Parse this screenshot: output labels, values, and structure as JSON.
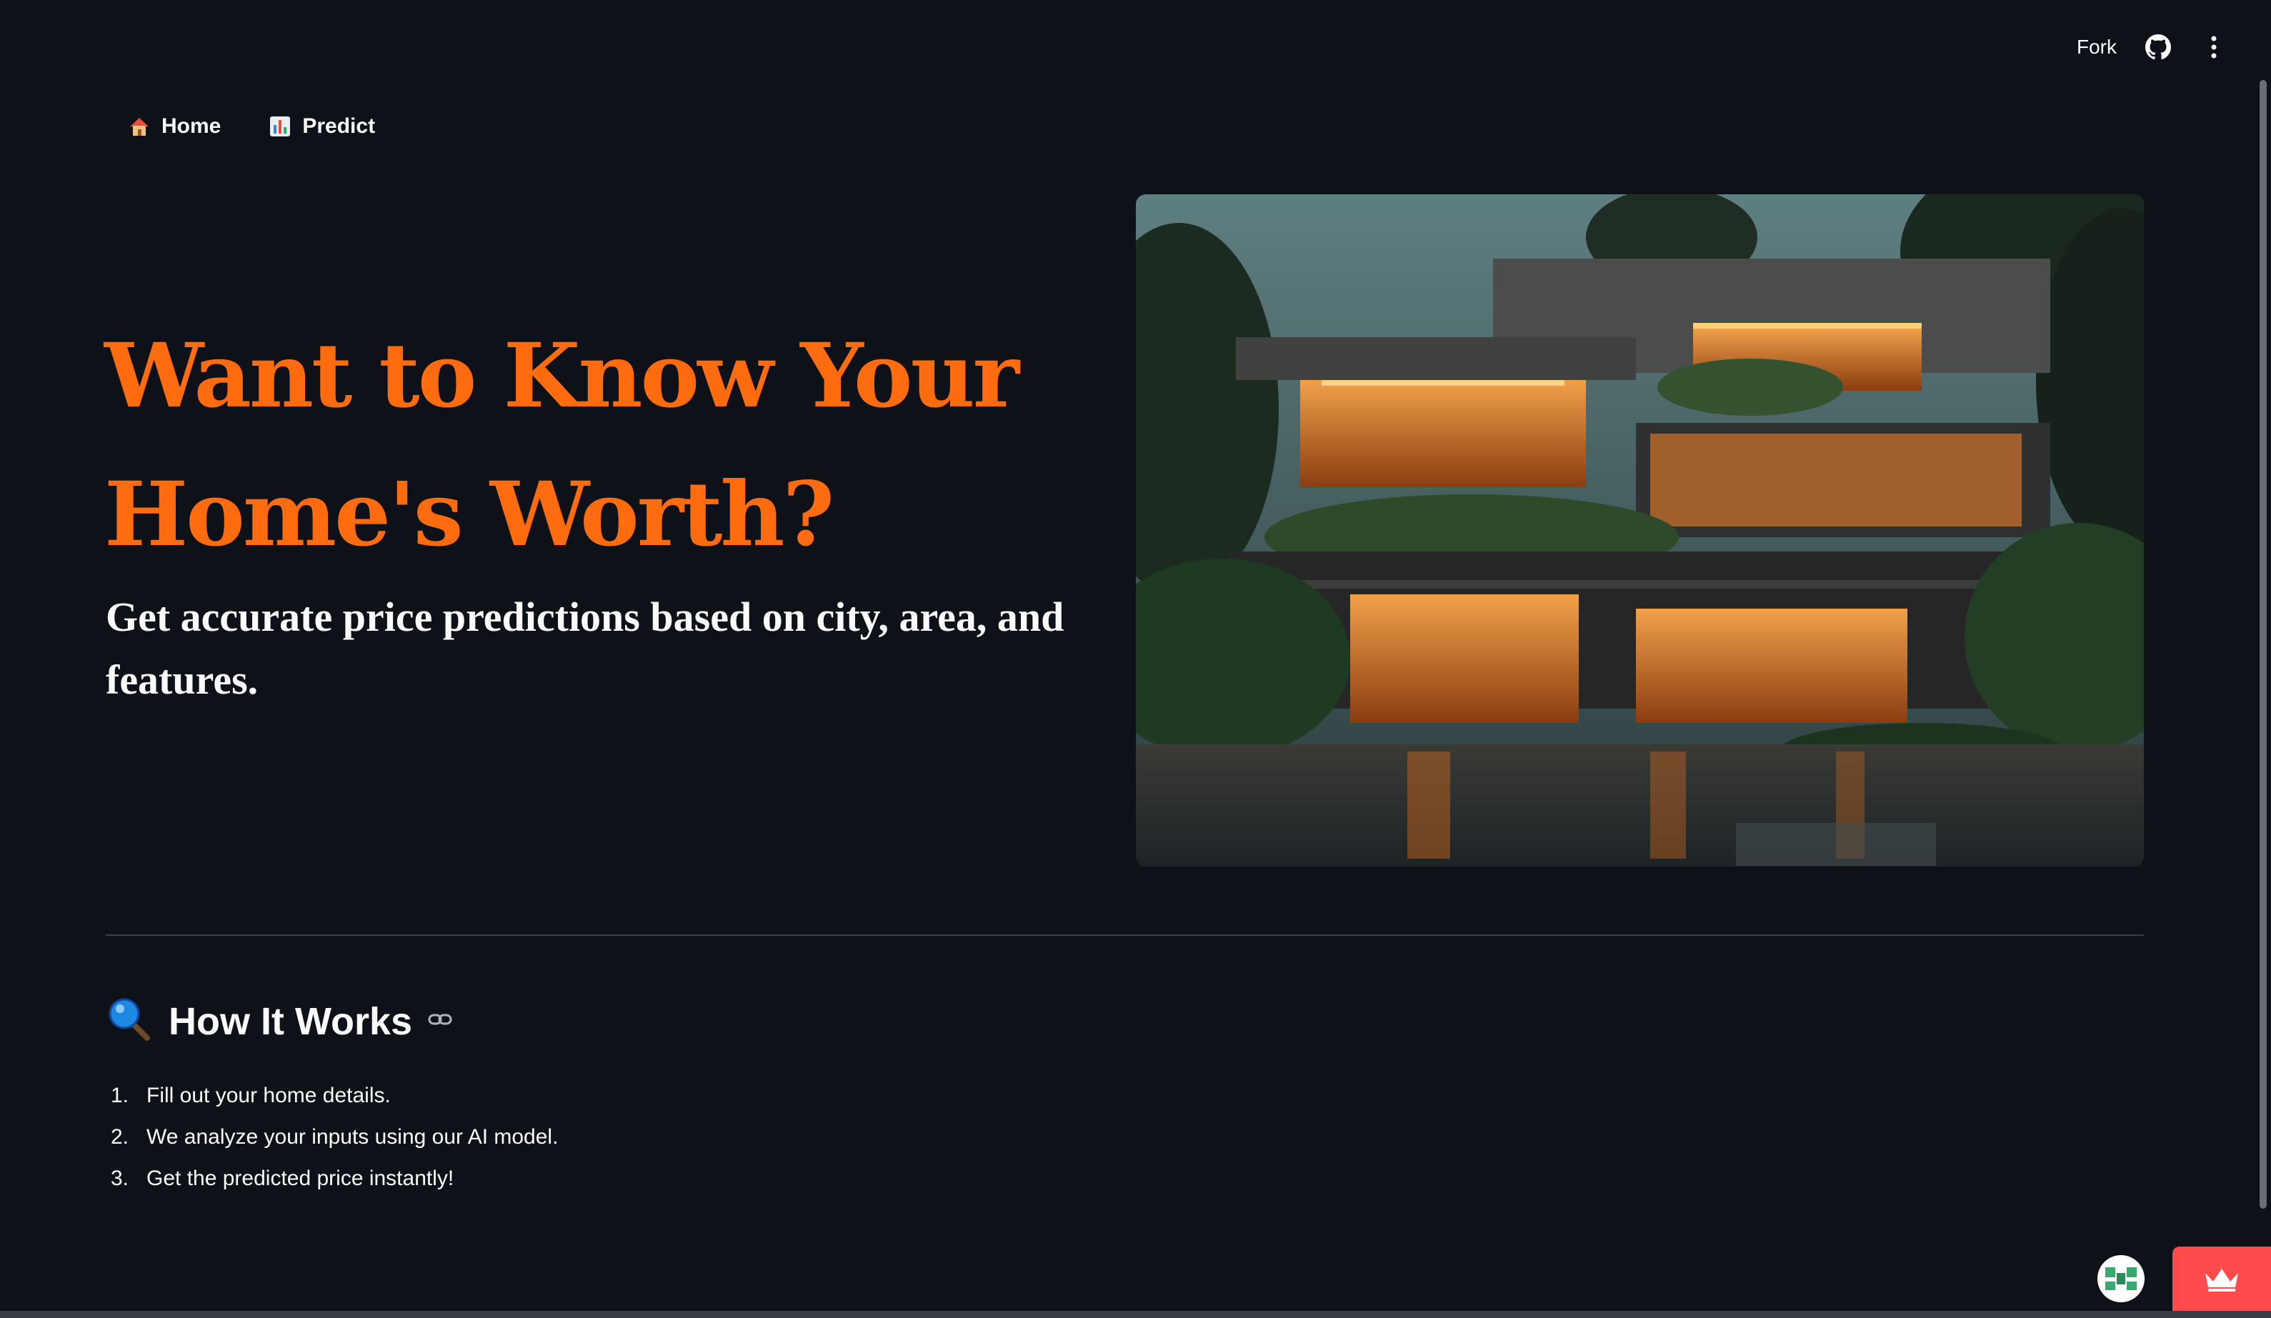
{
  "toolbar": {
    "fork_label": "Fork",
    "github_icon": "github-icon",
    "menu_icon": "more-vert-icon"
  },
  "nav": {
    "items": [
      {
        "label": "Home",
        "icon": "house-icon"
      },
      {
        "label": "Predict",
        "icon": "bar-chart-icon"
      }
    ]
  },
  "hero": {
    "title_line1": "Want to Know Your",
    "title_line2": "Home's Worth?",
    "subtitle": "Get accurate price predictions based on city, area, and features.",
    "accent_color": "#ff6b0f"
  },
  "how_it_works": {
    "title": "How It Works",
    "icon": "magnifier-icon",
    "steps": [
      {
        "num": "1.",
        "text": "Fill out your home details."
      },
      {
        "num": "2.",
        "text": "We analyze your inputs using our AI model."
      },
      {
        "num": "3.",
        "text": "Get the predicted price instantly!"
      }
    ]
  },
  "colors": {
    "background": "#0e1117",
    "badge_red": "#ff4b4b"
  }
}
